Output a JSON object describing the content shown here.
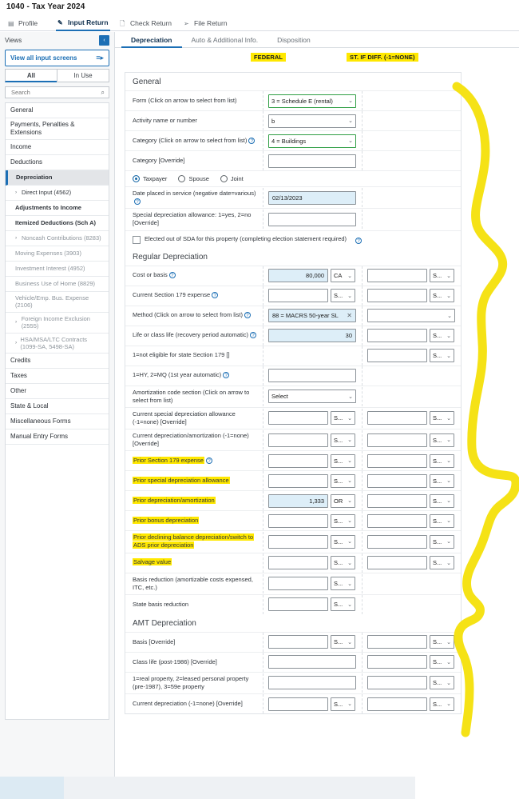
{
  "app": {
    "title": "1040 - Tax Year 2024"
  },
  "topnav": {
    "items": [
      {
        "label": "Profile",
        "icon": "grid-icon",
        "glyph": "▤",
        "active": false
      },
      {
        "label": "Input Return",
        "icon": "pencil-icon",
        "glyph": "✎",
        "active": true
      },
      {
        "label": "Check Return",
        "icon": "page-icon",
        "glyph": "🗋",
        "active": false
      },
      {
        "label": "File Return",
        "icon": "send-icon",
        "glyph": "➢",
        "active": false
      }
    ]
  },
  "sidebar": {
    "views_label": "Views",
    "collapse_glyph": "‹",
    "view_all_label": "View all input screens",
    "view_all_glyph": "≡▸",
    "segments": [
      {
        "label": "All",
        "active": true
      },
      {
        "label": "In Use",
        "active": false
      }
    ],
    "search": {
      "placeholder": "Search",
      "value": "",
      "icon_glyph": "⌕"
    },
    "items": [
      {
        "label": "General",
        "level": 0,
        "caret": "",
        "selected": false,
        "bold": false,
        "dim": false
      },
      {
        "label": "Payments, Penalties & Extensions",
        "level": 0,
        "caret": "",
        "selected": false,
        "bold": false,
        "dim": false
      },
      {
        "label": "Income",
        "level": 0,
        "caret": "",
        "selected": false,
        "bold": false,
        "dim": false
      },
      {
        "label": "Deductions",
        "level": 0,
        "caret": "",
        "selected": false,
        "bold": false,
        "dim": false
      },
      {
        "label": "Depreciation",
        "level": 1,
        "caret": "",
        "selected": true,
        "bold": true,
        "dim": false
      },
      {
        "label": "Direct Input (4562)",
        "level": 1,
        "caret": "›",
        "selected": false,
        "bold": false,
        "dim": false
      },
      {
        "label": "Adjustments to Income",
        "level": 1,
        "caret": "",
        "selected": false,
        "bold": true,
        "dim": false
      },
      {
        "label": "Itemized Deductions (Sch A)",
        "level": 1,
        "caret": "",
        "selected": false,
        "bold": true,
        "dim": false
      },
      {
        "label": "Noncash Contributions (8283)",
        "level": 1,
        "caret": "›",
        "selected": false,
        "bold": false,
        "dim": true
      },
      {
        "label": "Moving Expenses (3903)",
        "level": 1,
        "caret": "",
        "selected": false,
        "bold": false,
        "dim": true
      },
      {
        "label": "Investment Interest (4952)",
        "level": 1,
        "caret": "",
        "selected": false,
        "bold": false,
        "dim": true
      },
      {
        "label": "Business Use of Home (8829)",
        "level": 1,
        "caret": "",
        "selected": false,
        "bold": false,
        "dim": true
      },
      {
        "label": "Vehicle/Emp. Bus. Expense (2106)",
        "level": 1,
        "caret": "",
        "selected": false,
        "bold": false,
        "dim": true
      },
      {
        "label": "Foreign Income Exclusion (2555)",
        "level": 1,
        "caret": "›",
        "selected": false,
        "bold": false,
        "dim": true
      },
      {
        "label": "HSA/MSA/LTC Contracts (1099-SA, 5498-SA)",
        "level": 1,
        "caret": "›",
        "selected": false,
        "bold": false,
        "dim": true
      },
      {
        "label": "Credits",
        "level": 0,
        "caret": "",
        "selected": false,
        "bold": false,
        "dim": false
      },
      {
        "label": "Taxes",
        "level": 0,
        "caret": "",
        "selected": false,
        "bold": false,
        "dim": false
      },
      {
        "label": "Other",
        "level": 0,
        "caret": "",
        "selected": false,
        "bold": false,
        "dim": false
      },
      {
        "label": "State & Local",
        "level": 0,
        "caret": "",
        "selected": false,
        "bold": false,
        "dim": false
      },
      {
        "label": "Miscellaneous Forms",
        "level": 0,
        "caret": "",
        "selected": false,
        "bold": false,
        "dim": false
      },
      {
        "label": "Manual Entry Forms",
        "level": 0,
        "caret": "",
        "selected": false,
        "bold": false,
        "dim": false
      }
    ]
  },
  "main": {
    "subtabs": [
      {
        "label": "Depreciation",
        "active": true
      },
      {
        "label": "Auto & Additional Info.",
        "active": false
      },
      {
        "label": "Disposition",
        "active": false
      }
    ],
    "column_headers": [
      {
        "label": "FEDERAL",
        "highlighted": true
      },
      {
        "label": "ST. IF DIFF. (-1=NONE)",
        "highlighted": true
      }
    ],
    "sections": [
      {
        "title": "General",
        "rows": [
          {
            "label": "Form (Click on arrow to select from list)",
            "help": false,
            "hl": false,
            "fed": {
              "kind": "dropdown",
              "value": "3 = Schedule E (rental)",
              "green": true,
              "width": "wide"
            },
            "st": {
              "kind": "none"
            }
          },
          {
            "label": "Activity name or number",
            "help": false,
            "hl": false,
            "fed": {
              "kind": "dropdown",
              "value": "b",
              "green": false,
              "width": "wide"
            },
            "st": {
              "kind": "none"
            }
          },
          {
            "label": "Category (Click on arrow to select from list)",
            "help": true,
            "hl": false,
            "fed": {
              "kind": "dropdown",
              "value": "4 = Buildings",
              "green": true,
              "width": "wide"
            },
            "st": {
              "kind": "none"
            }
          },
          {
            "label": "Category [Override]",
            "help": false,
            "hl": false,
            "fed": {
              "kind": "text",
              "value": "",
              "filled": false,
              "width": "wide"
            },
            "st": {
              "kind": "none"
            }
          },
          {
            "kind": "radio",
            "options": [
              {
                "label": "Taxpayer",
                "selected": true
              },
              {
                "label": "Spouse",
                "selected": false
              },
              {
                "label": "Joint",
                "selected": false
              }
            ]
          },
          {
            "label": "Date placed in service (negative date=various)",
            "help": true,
            "hl": false,
            "fed": {
              "kind": "text",
              "value": "02/13/2023",
              "filled": true,
              "width": "wide",
              "align": "left"
            },
            "st": {
              "kind": "none"
            }
          },
          {
            "label": "Special depreciation allowance: 1=yes, 2=no [Override]",
            "help": false,
            "hl": false,
            "fed": {
              "kind": "text",
              "value": "",
              "filled": false,
              "width": "wide"
            },
            "st": {
              "kind": "none"
            }
          },
          {
            "kind": "checkbox",
            "checked": false,
            "help": true,
            "label": "Elected out of SDA for this property (completing election statement required)"
          }
        ]
      },
      {
        "title": "Regular Depreciation",
        "rows": [
          {
            "label": "Cost or basis",
            "help": true,
            "hl": false,
            "fed": {
              "kind": "num_unit",
              "value": "80,000",
              "filled": true,
              "unit": "CA"
            },
            "st": {
              "kind": "num_unit",
              "value": "",
              "filled": false,
              "unit": "S..."
            }
          },
          {
            "label": "Current Section 179 expense",
            "help": true,
            "hl": false,
            "fed": {
              "kind": "num_unit",
              "value": "",
              "filled": false,
              "unit": "S..."
            },
            "st": {
              "kind": "num_unit",
              "value": "",
              "filled": false,
              "unit": "S..."
            }
          },
          {
            "label": "Method (Click on arrow to select from list)",
            "help": true,
            "hl": false,
            "fed": {
              "kind": "tag",
              "value": "88 = MACRS 50-year SL",
              "clear_glyph": "✕"
            },
            "st": {
              "kind": "dropdown_full",
              "value": ""
            }
          },
          {
            "label": "Life or class life (recovery period automatic)",
            "help": true,
            "hl": false,
            "fed": {
              "kind": "text_num",
              "value": "30",
              "filled": true
            },
            "st": {
              "kind": "num_unit",
              "value": "",
              "filled": false,
              "unit": "S..."
            }
          },
          {
            "label": "1=not eligible for state Section 179 []",
            "help": false,
            "hl": false,
            "fed": {
              "kind": "none"
            },
            "st": {
              "kind": "num_unit",
              "value": "",
              "filled": false,
              "unit": "S..."
            }
          },
          {
            "label": "1=HY, 2=MQ (1st year automatic)",
            "help": true,
            "hl": false,
            "fed": {
              "kind": "text",
              "value": "",
              "filled": false,
              "width": "wide"
            },
            "st": {
              "kind": "none"
            }
          },
          {
            "label": "Amortization code section (Click on arrow to select from list)",
            "help": false,
            "hl": false,
            "fed": {
              "kind": "dropdown",
              "value": "Select",
              "green": false,
              "width": "wide"
            },
            "st": {
              "kind": "none"
            }
          },
          {
            "label": "Current special depreciation allowance (-1=none) [Override]",
            "help": false,
            "hl": false,
            "fed": {
              "kind": "num_unit",
              "value": "",
              "filled": false,
              "unit": "S..."
            },
            "st": {
              "kind": "num_unit",
              "value": "",
              "filled": false,
              "unit": "S..."
            }
          },
          {
            "label": "Current depreciation/amortization (-1=none) [Override]",
            "help": false,
            "hl": false,
            "fed": {
              "kind": "num_unit",
              "value": "",
              "filled": false,
              "unit": "S..."
            },
            "st": {
              "kind": "num_unit",
              "value": "",
              "filled": false,
              "unit": "S..."
            }
          },
          {
            "label": "Prior Section 179 expense",
            "help": true,
            "hl": true,
            "fed": {
              "kind": "num_unit",
              "value": "",
              "filled": false,
              "unit": "S..."
            },
            "st": {
              "kind": "num_unit",
              "value": "",
              "filled": false,
              "unit": "S..."
            }
          },
          {
            "label": "Prior special depreciation allowance",
            "help": false,
            "hl": true,
            "fed": {
              "kind": "num_unit",
              "value": "",
              "filled": false,
              "unit": "S..."
            },
            "st": {
              "kind": "num_unit",
              "value": "",
              "filled": false,
              "unit": "S..."
            }
          },
          {
            "label": "Prior depreciation/amortization",
            "help": false,
            "hl": true,
            "fed": {
              "kind": "num_unit",
              "value": "1,333",
              "filled": true,
              "unit": "OR"
            },
            "st": {
              "kind": "num_unit",
              "value": "",
              "filled": false,
              "unit": "S..."
            }
          },
          {
            "label": "Prior bonus depreciation",
            "help": false,
            "hl": true,
            "fed": {
              "kind": "num_unit",
              "value": "",
              "filled": false,
              "unit": "S..."
            },
            "st": {
              "kind": "num_unit",
              "value": "",
              "filled": false,
              "unit": "S..."
            }
          },
          {
            "label": "Prior declining balance depreciation/switch to ADS prior depreciation",
            "help": false,
            "hl": true,
            "fed": {
              "kind": "num_unit",
              "value": "",
              "filled": false,
              "unit": "S..."
            },
            "st": {
              "kind": "num_unit",
              "value": "",
              "filled": false,
              "unit": "S..."
            }
          },
          {
            "label": "Salvage value",
            "help": false,
            "hl": true,
            "fed": {
              "kind": "num_unit",
              "value": "",
              "filled": false,
              "unit": "S..."
            },
            "st": {
              "kind": "num_unit",
              "value": "",
              "filled": false,
              "unit": "S..."
            }
          },
          {
            "label": "Basis reduction (amortizable costs expensed, ITC, etc.)",
            "help": false,
            "hl": false,
            "fed": {
              "kind": "num_unit",
              "value": "",
              "filled": false,
              "unit": "S..."
            },
            "st": {
              "kind": "none"
            }
          },
          {
            "label": "State basis reduction",
            "help": false,
            "hl": false,
            "fed": {
              "kind": "num_unit",
              "value": "",
              "filled": false,
              "unit": "S..."
            },
            "st": {
              "kind": "none"
            }
          }
        ]
      },
      {
        "title": "AMT Depreciation",
        "rows": [
          {
            "label": "Basis [Override]",
            "help": false,
            "hl": false,
            "fed": {
              "kind": "num_unit",
              "value": "",
              "filled": false,
              "unit": "S..."
            },
            "st": {
              "kind": "num_unit",
              "value": "",
              "filled": false,
              "unit": "S..."
            }
          },
          {
            "label": "Class life (post-1986) [Override]",
            "help": false,
            "hl": false,
            "fed": {
              "kind": "text",
              "value": "",
              "filled": false,
              "width": "wide"
            },
            "st": {
              "kind": "num_unit",
              "value": "",
              "filled": false,
              "unit": "S..."
            }
          },
          {
            "label": "1=real property, 2=leased personal property (pre-1987), 3=59e property",
            "help": false,
            "hl": false,
            "fed": {
              "kind": "text",
              "value": "",
              "filled": false,
              "width": "wide"
            },
            "st": {
              "kind": "num_unit",
              "value": "",
              "filled": false,
              "unit": "S..."
            }
          },
          {
            "label": "Current depreciation (-1=none) [Override]",
            "help": false,
            "hl": false,
            "fed": {
              "kind": "num_unit",
              "value": "",
              "filled": false,
              "unit": "S..."
            },
            "st": {
              "kind": "num_unit",
              "value": "",
              "filled": false,
              "unit": "S..."
            }
          }
        ]
      }
    ]
  },
  "annotation": {
    "marker_color": "#f5e216",
    "highlight_color": "#ffe800",
    "description": "hand-drawn yellow marker squiggle down right side"
  }
}
